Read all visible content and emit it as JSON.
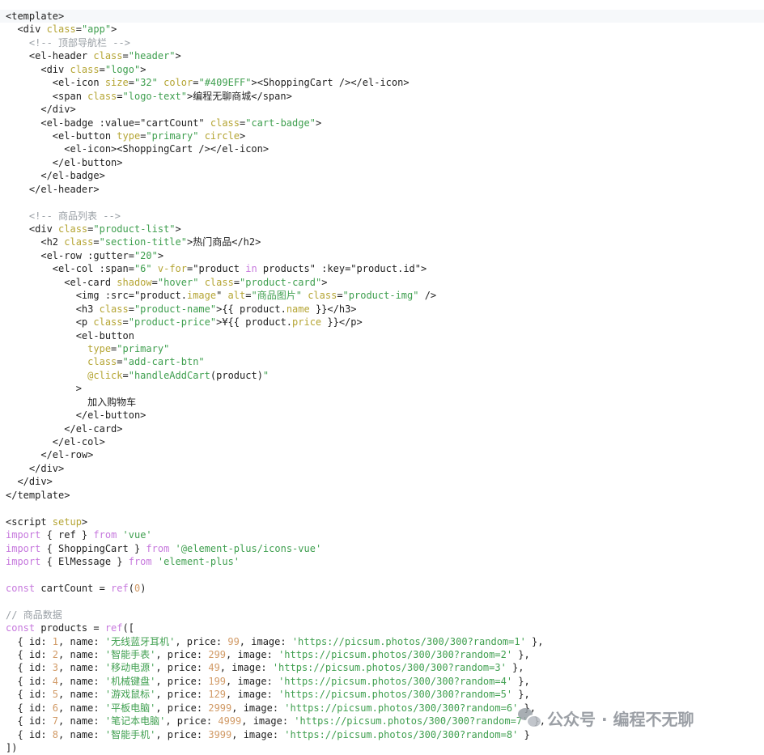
{
  "lines": [
    [
      [
        "t-pl",
        "<template>"
      ]
    ],
    [
      [
        "t-pl",
        "  <div "
      ],
      [
        "t-attr",
        "class"
      ],
      [
        "t-pl",
        "="
      ],
      [
        "t-str",
        "\"app\""
      ],
      [
        "t-pl",
        ">"
      ]
    ],
    [
      [
        "t-cm",
        "    <!-- "
      ],
      [
        "t-cmcn",
        "顶部导航栏"
      ],
      [
        "t-cm",
        " -->"
      ]
    ],
    [
      [
        "t-pl",
        "    <el-header "
      ],
      [
        "t-attr",
        "class"
      ],
      [
        "t-pl",
        "="
      ],
      [
        "t-str",
        "\"header\""
      ],
      [
        "t-pl",
        ">"
      ]
    ],
    [
      [
        "t-pl",
        "      <div "
      ],
      [
        "t-attr",
        "class"
      ],
      [
        "t-pl",
        "="
      ],
      [
        "t-str",
        "\"logo\""
      ],
      [
        "t-pl",
        ">"
      ]
    ],
    [
      [
        "t-pl",
        "        <el-icon "
      ],
      [
        "t-attr",
        "size"
      ],
      [
        "t-pl",
        "="
      ],
      [
        "t-str",
        "\"32\""
      ],
      [
        "t-pl",
        " "
      ],
      [
        "t-attr",
        "color"
      ],
      [
        "t-pl",
        "="
      ],
      [
        "t-str",
        "\"#409EFF\""
      ],
      [
        "t-pl",
        "><ShoppingCart /></el-icon>"
      ]
    ],
    [
      [
        "t-pl",
        "        <span "
      ],
      [
        "t-attr",
        "class"
      ],
      [
        "t-pl",
        "="
      ],
      [
        "t-str",
        "\"logo-text\""
      ],
      [
        "t-pl",
        ">"
      ],
      [
        "t-cn",
        "编程无聊商城"
      ],
      [
        "t-pl",
        "</span>"
      ]
    ],
    [
      [
        "t-pl",
        "      </div>"
      ]
    ],
    [
      [
        "t-pl",
        "      <el-badge :value="
      ],
      [
        "t-pl",
        "\"cartCount\" "
      ],
      [
        "t-attr",
        "class"
      ],
      [
        "t-pl",
        "="
      ],
      [
        "t-str",
        "\"cart-badge\""
      ],
      [
        "t-pl",
        ">"
      ]
    ],
    [
      [
        "t-pl",
        "        <el-button "
      ],
      [
        "t-attr",
        "type"
      ],
      [
        "t-pl",
        "="
      ],
      [
        "t-str",
        "\"primary\""
      ],
      [
        "t-pl",
        " "
      ],
      [
        "t-attr",
        "circle"
      ],
      [
        "t-pl",
        ">"
      ]
    ],
    [
      [
        "t-pl",
        "          <el-icon><ShoppingCart /></el-icon>"
      ]
    ],
    [
      [
        "t-pl",
        "        </el-button>"
      ]
    ],
    [
      [
        "t-pl",
        "      </el-badge>"
      ]
    ],
    [
      [
        "t-pl",
        "    </el-header>"
      ]
    ],
    [
      [
        "t-pl",
        ""
      ]
    ],
    [
      [
        "t-cm",
        "    <!-- "
      ],
      [
        "t-cmcn",
        "商品列表"
      ],
      [
        "t-cm",
        " -->"
      ]
    ],
    [
      [
        "t-pl",
        "    <div "
      ],
      [
        "t-attr",
        "class"
      ],
      [
        "t-pl",
        "="
      ],
      [
        "t-str",
        "\"product-list\""
      ],
      [
        "t-pl",
        ">"
      ]
    ],
    [
      [
        "t-pl",
        "      <h2 "
      ],
      [
        "t-attr",
        "class"
      ],
      [
        "t-pl",
        "="
      ],
      [
        "t-str",
        "\"section-title\""
      ],
      [
        "t-pl",
        ">"
      ],
      [
        "t-cn",
        "热门商品"
      ],
      [
        "t-pl",
        "</h2>"
      ]
    ],
    [
      [
        "t-pl",
        "      <el-row :gutter="
      ],
      [
        "t-str",
        "\"20\""
      ],
      [
        "t-pl",
        ">"
      ]
    ],
    [
      [
        "t-pl",
        "        <el-col :span="
      ],
      [
        "t-str",
        "\"6\""
      ],
      [
        "t-pl",
        " "
      ],
      [
        "t-attr",
        "v-for"
      ],
      [
        "t-pl",
        "=\"product "
      ],
      [
        "t-kw",
        "in"
      ],
      [
        "t-pl",
        " products\" :key=\"product.id\">"
      ]
    ],
    [
      [
        "t-pl",
        "          <el-card "
      ],
      [
        "t-attr",
        "shadow"
      ],
      [
        "t-pl",
        "="
      ],
      [
        "t-str",
        "\"hover\""
      ],
      [
        "t-pl",
        " "
      ],
      [
        "t-attr",
        "class"
      ],
      [
        "t-pl",
        "="
      ],
      [
        "t-str",
        "\"product-card\""
      ],
      [
        "t-pl",
        ">"
      ]
    ],
    [
      [
        "t-pl",
        "            <img :src=\"product."
      ],
      [
        "t-attr",
        "image"
      ],
      [
        "t-pl",
        "\" "
      ],
      [
        "t-attr",
        "alt"
      ],
      [
        "t-pl",
        "="
      ],
      [
        "t-str",
        "\""
      ],
      [
        "t-strcn",
        "商品图片"
      ],
      [
        "t-str",
        "\""
      ],
      [
        "t-pl",
        " "
      ],
      [
        "t-attr",
        "class"
      ],
      [
        "t-pl",
        "="
      ],
      [
        "t-str",
        "\"product-img\""
      ],
      [
        "t-pl",
        " />"
      ]
    ],
    [
      [
        "t-pl",
        "            <h3 "
      ],
      [
        "t-attr",
        "class"
      ],
      [
        "t-pl",
        "="
      ],
      [
        "t-str",
        "\"product-name\""
      ],
      [
        "t-pl",
        ">{{ product."
      ],
      [
        "t-attr",
        "name"
      ],
      [
        "t-pl",
        " }}</h3>"
      ]
    ],
    [
      [
        "t-pl",
        "            <p "
      ],
      [
        "t-attr",
        "class"
      ],
      [
        "t-pl",
        "="
      ],
      [
        "t-str",
        "\"product-price\""
      ],
      [
        "t-pl",
        ">¥{{ product."
      ],
      [
        "t-attr",
        "price"
      ],
      [
        "t-pl",
        " }}</p>"
      ]
    ],
    [
      [
        "t-pl",
        "            <el-button"
      ]
    ],
    [
      [
        "t-attr",
        "              type"
      ],
      [
        "t-pl",
        "="
      ],
      [
        "t-str",
        "\"primary\""
      ]
    ],
    [
      [
        "t-attr",
        "              class"
      ],
      [
        "t-pl",
        "="
      ],
      [
        "t-str",
        "\"add-cart-btn\""
      ]
    ],
    [
      [
        "t-attr",
        "              @click"
      ],
      [
        "t-pl",
        "="
      ],
      [
        "t-str",
        "\"handleAddCart"
      ],
      [
        "t-pl",
        "(product)"
      ],
      [
        "t-str",
        "\""
      ]
    ],
    [
      [
        "t-pl",
        "            >"
      ]
    ],
    [
      [
        "t-pl",
        "              "
      ],
      [
        "t-cn",
        "加入购物车"
      ]
    ],
    [
      [
        "t-pl",
        "            </el-button>"
      ]
    ],
    [
      [
        "t-pl",
        "          </el-card>"
      ]
    ],
    [
      [
        "t-pl",
        "        </el-col>"
      ]
    ],
    [
      [
        "t-pl",
        "      </el-row>"
      ]
    ],
    [
      [
        "t-pl",
        "    </div>"
      ]
    ],
    [
      [
        "t-pl",
        "  </div>"
      ]
    ],
    [
      [
        "t-pl",
        "</template>"
      ]
    ],
    [
      [
        "t-pl",
        ""
      ]
    ],
    [
      [
        "t-pl",
        "<script "
      ],
      [
        "t-attr",
        "setup"
      ],
      [
        "t-pl",
        ">"
      ]
    ],
    [
      [
        "t-kw",
        "import"
      ],
      [
        "t-pl",
        " { ref } "
      ],
      [
        "t-kw",
        "from"
      ],
      [
        "t-pl",
        " "
      ],
      [
        "t-str",
        "'vue'"
      ]
    ],
    [
      [
        "t-kw",
        "import"
      ],
      [
        "t-pl",
        " { ShoppingCart } "
      ],
      [
        "t-kw",
        "from"
      ],
      [
        "t-pl",
        " "
      ],
      [
        "t-str",
        "'@element-plus/icons-vue'"
      ]
    ],
    [
      [
        "t-kw",
        "import"
      ],
      [
        "t-pl",
        " { ElMessage } "
      ],
      [
        "t-kw",
        "from"
      ],
      [
        "t-pl",
        " "
      ],
      [
        "t-str",
        "'element-plus'"
      ]
    ],
    [
      [
        "t-pl",
        ""
      ]
    ],
    [
      [
        "t-kw",
        "const"
      ],
      [
        "t-pl",
        " cartCount = "
      ],
      [
        "t-kw",
        "ref"
      ],
      [
        "t-pl",
        "("
      ],
      [
        "t-num",
        "0"
      ],
      [
        "t-pl",
        ")"
      ]
    ],
    [
      [
        "t-pl",
        ""
      ]
    ],
    [
      [
        "t-cm",
        "// "
      ],
      [
        "t-cmcn",
        "商品数据"
      ]
    ],
    [
      [
        "t-kw",
        "const"
      ],
      [
        "t-pl",
        " products = "
      ],
      [
        "t-kw",
        "ref"
      ],
      [
        "t-pl",
        "(["
      ]
    ],
    [
      [
        "t-pl",
        "  { id: "
      ],
      [
        "t-num",
        "1"
      ],
      [
        "t-pl",
        ", name: "
      ],
      [
        "t-str",
        "'"
      ],
      [
        "t-strcn",
        "无线蓝牙耳机"
      ],
      [
        "t-str",
        "'"
      ],
      [
        "t-pl",
        ", price: "
      ],
      [
        "t-num",
        "99"
      ],
      [
        "t-pl",
        ", image: "
      ],
      [
        "t-str",
        "'https://picsum.photos/300/300?random=1'"
      ],
      [
        "t-pl",
        " },"
      ]
    ],
    [
      [
        "t-pl",
        "  { id: "
      ],
      [
        "t-num",
        "2"
      ],
      [
        "t-pl",
        ", name: "
      ],
      [
        "t-str",
        "'"
      ],
      [
        "t-strcn",
        "智能手表"
      ],
      [
        "t-str",
        "'"
      ],
      [
        "t-pl",
        ", price: "
      ],
      [
        "t-num",
        "299"
      ],
      [
        "t-pl",
        ", image: "
      ],
      [
        "t-str",
        "'https://picsum.photos/300/300?random=2'"
      ],
      [
        "t-pl",
        " },"
      ]
    ],
    [
      [
        "t-pl",
        "  { id: "
      ],
      [
        "t-num",
        "3"
      ],
      [
        "t-pl",
        ", name: "
      ],
      [
        "t-str",
        "'"
      ],
      [
        "t-strcn",
        "移动电源"
      ],
      [
        "t-str",
        "'"
      ],
      [
        "t-pl",
        ", price: "
      ],
      [
        "t-num",
        "49"
      ],
      [
        "t-pl",
        ", image: "
      ],
      [
        "t-str",
        "'https://picsum.photos/300/300?random=3'"
      ],
      [
        "t-pl",
        " },"
      ]
    ],
    [
      [
        "t-pl",
        "  { id: "
      ],
      [
        "t-num",
        "4"
      ],
      [
        "t-pl",
        ", name: "
      ],
      [
        "t-str",
        "'"
      ],
      [
        "t-strcn",
        "机械键盘"
      ],
      [
        "t-str",
        "'"
      ],
      [
        "t-pl",
        ", price: "
      ],
      [
        "t-num",
        "199"
      ],
      [
        "t-pl",
        ", image: "
      ],
      [
        "t-str",
        "'https://picsum.photos/300/300?random=4'"
      ],
      [
        "t-pl",
        " },"
      ]
    ],
    [
      [
        "t-pl",
        "  { id: "
      ],
      [
        "t-num",
        "5"
      ],
      [
        "t-pl",
        ", name: "
      ],
      [
        "t-str",
        "'"
      ],
      [
        "t-strcn",
        "游戏鼠标"
      ],
      [
        "t-str",
        "'"
      ],
      [
        "t-pl",
        ", price: "
      ],
      [
        "t-num",
        "129"
      ],
      [
        "t-pl",
        ", image: "
      ],
      [
        "t-str",
        "'https://picsum.photos/300/300?random=5'"
      ],
      [
        "t-pl",
        " },"
      ]
    ],
    [
      [
        "t-pl",
        "  { id: "
      ],
      [
        "t-num",
        "6"
      ],
      [
        "t-pl",
        ", name: "
      ],
      [
        "t-str",
        "'"
      ],
      [
        "t-strcn",
        "平板电脑"
      ],
      [
        "t-str",
        "'"
      ],
      [
        "t-pl",
        ", price: "
      ],
      [
        "t-num",
        "2999"
      ],
      [
        "t-pl",
        ", image: "
      ],
      [
        "t-str",
        "'https://picsum.photos/300/300?random=6'"
      ],
      [
        "t-pl",
        " },"
      ]
    ],
    [
      [
        "t-pl",
        "  { id: "
      ],
      [
        "t-num",
        "7"
      ],
      [
        "t-pl",
        ", name: "
      ],
      [
        "t-str",
        "'"
      ],
      [
        "t-strcn",
        "笔记本电脑"
      ],
      [
        "t-str",
        "'"
      ],
      [
        "t-pl",
        ", price: "
      ],
      [
        "t-num",
        "4999"
      ],
      [
        "t-pl",
        ", image: "
      ],
      [
        "t-str",
        "'https://picsum.photos/300/300?random=7'"
      ],
      [
        "t-pl",
        " },"
      ]
    ],
    [
      [
        "t-pl",
        "  { id: "
      ],
      [
        "t-num",
        "8"
      ],
      [
        "t-pl",
        ", name: "
      ],
      [
        "t-str",
        "'"
      ],
      [
        "t-strcn",
        "智能手机"
      ],
      [
        "t-str",
        "'"
      ],
      [
        "t-pl",
        ", price: "
      ],
      [
        "t-num",
        "3999"
      ],
      [
        "t-pl",
        ", image: "
      ],
      [
        "t-str",
        "'https://picsum.photos/300/300?random=8'"
      ],
      [
        "t-pl",
        " }"
      ]
    ],
    [
      [
        "t-pl",
        "])"
      ]
    ]
  ],
  "watermark": {
    "text": "公众号 · 编程不无聊",
    "icon": "wechat-icon"
  }
}
